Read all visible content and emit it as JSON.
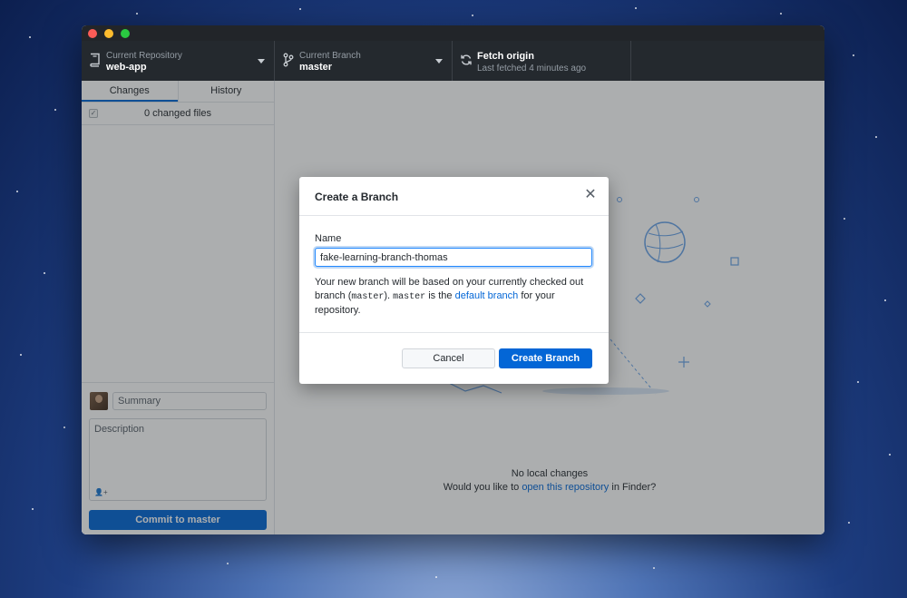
{
  "window": {
    "controls": [
      "close",
      "minimize",
      "zoom"
    ]
  },
  "toolbar": {
    "repository": {
      "title": "Current Repository",
      "value": "web-app",
      "icon": "repo-icon"
    },
    "branch": {
      "title": "Current Branch",
      "value": "master",
      "icon": "git-branch-icon"
    },
    "fetch": {
      "title": "Fetch origin",
      "subtitle": "Last fetched 4 minutes ago",
      "icon": "sync-icon"
    }
  },
  "sidebar": {
    "tabs": [
      {
        "label": "Changes",
        "active": true
      },
      {
        "label": "History",
        "active": false
      }
    ],
    "changed_files_label": "0 changed files",
    "select_all_checked": true,
    "commit": {
      "summary_placeholder": "Summary",
      "description_placeholder": "Description",
      "button_label": "Commit to master"
    }
  },
  "main": {
    "blankslate": {
      "title": "No local changes",
      "prompt_prefix": "Would you like to ",
      "prompt_link": "open this repository",
      "prompt_suffix": " in Finder?"
    }
  },
  "dialog": {
    "title": "Create a Branch",
    "name_label": "Name",
    "name_value": "fake-learning-branch-thomas",
    "help": {
      "part1": "Your new branch will be based on your currently checked out branch (",
      "code1": "master",
      "part2": "). ",
      "code2": "master",
      "part3": " is the ",
      "link": "default branch",
      "part4": " for your repository."
    },
    "cancel_label": "Cancel",
    "create_label": "Create Branch"
  },
  "colors": {
    "toolbar_bg": "#24292e",
    "accent_blue": "#0366d6",
    "overlay": "rgba(36,41,46,0.38)"
  }
}
